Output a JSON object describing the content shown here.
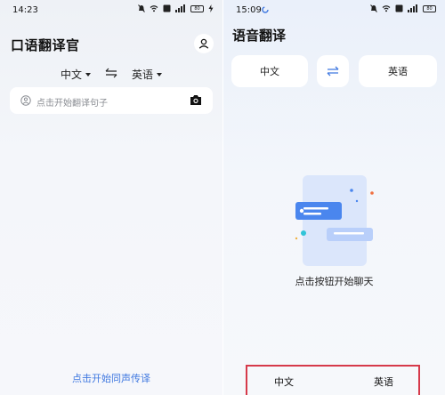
{
  "left": {
    "status": {
      "time": "14:23",
      "battery": "80"
    },
    "title": "口语翻译官",
    "source_lang": "中文",
    "target_lang": "英语",
    "search": {
      "placeholder": "点击开始翻译句子"
    },
    "simultaneous_link": "点击开始同声传译"
  },
  "right": {
    "status": {
      "time": "15:09",
      "battery": "80"
    },
    "title": "语音翻译",
    "source_lang": "中文",
    "target_lang": "英语",
    "empty_hint": "点击按钮开始聊天",
    "bottom": {
      "left_label": "中文",
      "right_label": "英语"
    }
  },
  "colors": {
    "accent": "#3f78e0",
    "highlight_border": "#d63a4a",
    "illustration": "#4a86ee"
  }
}
